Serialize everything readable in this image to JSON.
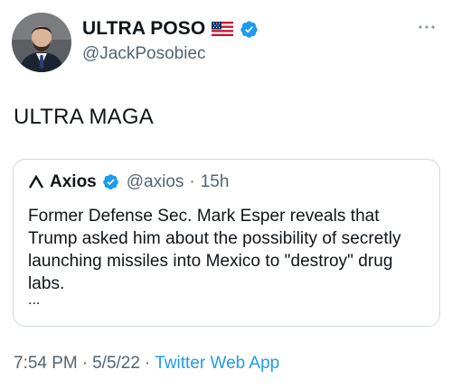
{
  "author": {
    "display_name": "ULTRA POSO",
    "handle": "@JackPosobiec",
    "flag_icon": "us-flag-icon",
    "verified_icon": "verified-badge-icon"
  },
  "tweet": {
    "text": "ULTRA MAGA",
    "more_icon": "more-options-icon"
  },
  "quote": {
    "logo_icon": "axios-logo-icon",
    "name": "Axios",
    "handle": "@axios",
    "separator": "·",
    "time": "15h",
    "text": "Former Defense Sec. Mark Esper reveals that Trump asked him about the possibility of secretly launching missiles into Mexico to \"destroy\" drug labs.",
    "ellipsis": "..."
  },
  "meta": {
    "time": "7:54 PM",
    "sep1": "·",
    "date": "5/5/22",
    "sep2": "·",
    "source": "Twitter Web App"
  },
  "colors": {
    "text": "#0f1419",
    "secondary": "#536471",
    "link": "#1d9bf0",
    "verified": "#1d9bf0",
    "border": "#cfd9de"
  }
}
